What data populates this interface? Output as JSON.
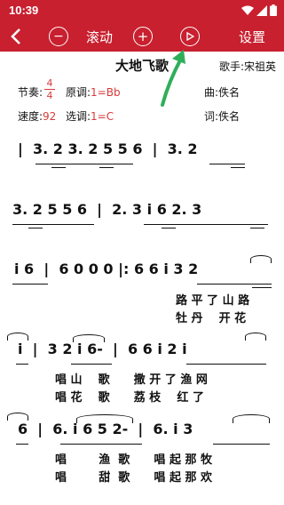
{
  "status": {
    "time": "10:39"
  },
  "toolbar": {
    "back": "<",
    "scroll_label": "滚动",
    "settings_label": "设置",
    "minus": "−",
    "plus": "+",
    "play": "▷"
  },
  "song": {
    "title": "大地飞歌",
    "singer": "歌手:宋祖英",
    "beat_label": "节奏:",
    "beat_top": "4",
    "beat_bottom": "4",
    "orig_key_label": "原调:",
    "orig_key": "1=Bb",
    "composer": "曲:佚名",
    "tempo_label": "速度:",
    "tempo": "92",
    "sel_key_label": "选调:",
    "sel_key": "1=C",
    "lyricist": "词:佚名"
  },
  "score": {
    "line1": "|  3. 2 3. 2 5 5 6  |  3. 2",
    "line2": "3. 2 5 5 6  |  2. 3 i 6 2. 3",
    "line3": "i 6  |  6 0 0 0 |: 6 6 i 3 2",
    "line3_lyric1": "路 平 了 山 路",
    "line3_lyric2": "牡 丹    开 花",
    "line4": "i  |  3 2 i 6-  |  6 6 i 2 i",
    "line4_lyric1": "唱 山    歌      撒 开 了 渔 网",
    "line4_lyric2": "唱 花    歌      荔 枝    红 了",
    "line5": "6  |  6. i 6 5 2-  |  6. i 3",
    "line5_lyric1": "唱        渔  歌      唱 起 那 牧",
    "line5_lyric2": "唱        甜  歌      唱 起 那 欢"
  },
  "colors": {
    "toolbar_bg": "#c8202f",
    "accent_red": "#d93a3a",
    "arrow_green": "#2fae5a"
  }
}
